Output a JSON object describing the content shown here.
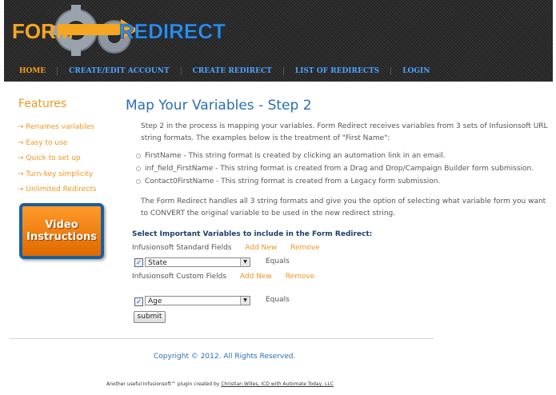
{
  "logo": {
    "part1": "FORM",
    "part2": "REDIRECT",
    "colors": {
      "form": "#f5a623",
      "redirect": "#2f8fe8"
    }
  },
  "nav": {
    "items": [
      {
        "label": "HOME",
        "active": true
      },
      {
        "label": "CREATE/EDIT ACCOUNT"
      },
      {
        "label": "CREATE REDIRECT"
      },
      {
        "label": "LIST OF REDIRECTS"
      },
      {
        "label": "LOGIN"
      }
    ]
  },
  "sidebar": {
    "title": "Features",
    "features": [
      "→ Renames variables",
      "→ Easy to use",
      "→ Quick to set up",
      "→ Turn-key simplicity",
      "→ Unlimited Redirects"
    ],
    "video_label_1": "Video",
    "video_label_2": "Instructions"
  },
  "main": {
    "title": "Map Your Variables - Step 2",
    "intro": "Step 2 in the process is mapping your variables. Form Redirect receives variables from 3 sets of Infusionsoft URL string formats. The examples below is the treatment of \"First Name\":",
    "bullets": [
      "FirstName - This string format is created by clicking an automation link in an email.",
      "inf_field_FirstName - This string format is created from a Drag and Drop/Campaign Builder form submission.",
      "Contact0FirstName - This string format is created from a Legacy form submission."
    ],
    "outro": "The Form Redirect handles all 3 string formats and give you the option of selecting what variable form you want to CONVERT the original variable to be used in the new redirect string.",
    "form_title": "Select Important Variables to include in the Form Redirect:",
    "standard_label": "Infusionsoft Standard Fields",
    "custom_label": "Infusionsoft Custom Fields",
    "add_new": "Add New",
    "remove": "Remove",
    "standard_select": "State",
    "custom_select": "Age",
    "equals": "Equals",
    "submit": "submit"
  },
  "footer": {
    "copyright": "Copyright © 2012. All Rights Reserved.",
    "credit_prefix": "Another useful Infusionsoft™ plugin created by ",
    "credit_link": "Christian Willes, ICD with Automate Today, LLC"
  }
}
